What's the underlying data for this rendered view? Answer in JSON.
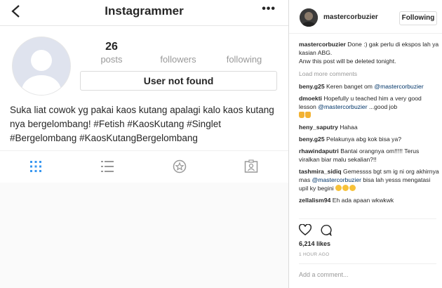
{
  "profile": {
    "title": "Instagrammer",
    "more": "•••",
    "posts_count": "26",
    "posts_label": "posts",
    "followers_label": "followers",
    "following_label": "following",
    "user_not_found": "User not found",
    "bio": "Suka liat cowok yg pakai kaos kutang apalagi kalo kaos kutang nya bergelombang! #Fetish #KaosKutang #Singlet #Bergelombang #KaosKutangBergelombang"
  },
  "post_panel": {
    "username": "mastercorbuzier",
    "follow_label": "Following",
    "caption": {
      "user": "mastercorbuzier",
      "text": "Done :) gak perlu di ekspos lah ya kasian ABG.",
      "text2": "Anw this post will be deleted tonight."
    },
    "load_more": "Load more comments",
    "comments": [
      {
        "user": "beny.g25",
        "text": "Keren banget om",
        "mention": "@mastercorbuzier"
      },
      {
        "user": "dmoekti",
        "text": "Hopefully u teached him a very good lesson",
        "mention": "@mastercorbuzier",
        "after": "...good job"
      },
      {
        "user": "heny_saputry",
        "text": "Hahaa"
      },
      {
        "user": "beny.g25",
        "text": "Pelakunya abg kok bisa ya?"
      },
      {
        "user": "rhawindaputri",
        "text": "Bantai orangnya om!!!!! Terus viralkan biar malu sekalian?!!"
      },
      {
        "user": "tashmira_sidiq",
        "text": "Gemessss bgt sm ig ni org akhirnya mas",
        "mention": "@mastercorbuzier",
        "after": "bisa lah yesss mengatasi upil ky begini"
      },
      {
        "user": "zellalism94",
        "text": "Eh ada apaan wkwkwk"
      }
    ],
    "likes": "6,214 likes",
    "time": "1 HOUR AGO",
    "add_comment_placeholder": "Add a comment...",
    "colors": {
      "mention": "#003569",
      "muted": "#999999",
      "border": "#dbdbdb"
    },
    "icons": [
      "heart-icon",
      "comment-icon"
    ]
  }
}
